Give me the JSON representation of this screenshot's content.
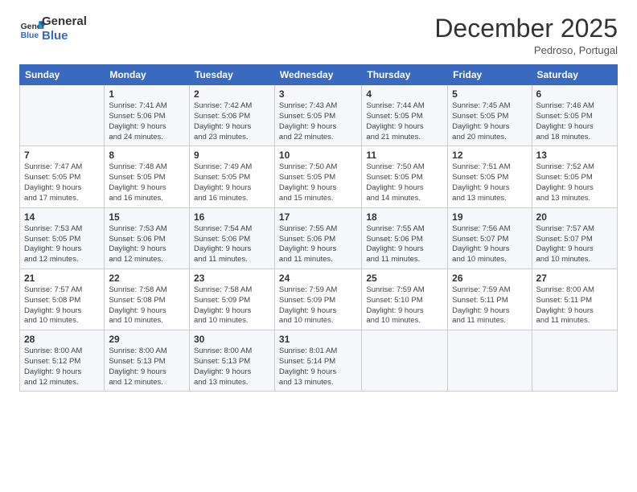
{
  "header": {
    "logo_line1": "General",
    "logo_line2": "Blue",
    "month_title": "December 2025",
    "location": "Pedroso, Portugal"
  },
  "weekdays": [
    "Sunday",
    "Monday",
    "Tuesday",
    "Wednesday",
    "Thursday",
    "Friday",
    "Saturday"
  ],
  "weeks": [
    [
      {
        "day": "",
        "info": ""
      },
      {
        "day": "1",
        "info": "Sunrise: 7:41 AM\nSunset: 5:06 PM\nDaylight: 9 hours\nand 24 minutes."
      },
      {
        "day": "2",
        "info": "Sunrise: 7:42 AM\nSunset: 5:06 PM\nDaylight: 9 hours\nand 23 minutes."
      },
      {
        "day": "3",
        "info": "Sunrise: 7:43 AM\nSunset: 5:05 PM\nDaylight: 9 hours\nand 22 minutes."
      },
      {
        "day": "4",
        "info": "Sunrise: 7:44 AM\nSunset: 5:05 PM\nDaylight: 9 hours\nand 21 minutes."
      },
      {
        "day": "5",
        "info": "Sunrise: 7:45 AM\nSunset: 5:05 PM\nDaylight: 9 hours\nand 20 minutes."
      },
      {
        "day": "6",
        "info": "Sunrise: 7:46 AM\nSunset: 5:05 PM\nDaylight: 9 hours\nand 18 minutes."
      }
    ],
    [
      {
        "day": "7",
        "info": "Sunrise: 7:47 AM\nSunset: 5:05 PM\nDaylight: 9 hours\nand 17 minutes."
      },
      {
        "day": "8",
        "info": "Sunrise: 7:48 AM\nSunset: 5:05 PM\nDaylight: 9 hours\nand 16 minutes."
      },
      {
        "day": "9",
        "info": "Sunrise: 7:49 AM\nSunset: 5:05 PM\nDaylight: 9 hours\nand 16 minutes."
      },
      {
        "day": "10",
        "info": "Sunrise: 7:50 AM\nSunset: 5:05 PM\nDaylight: 9 hours\nand 15 minutes."
      },
      {
        "day": "11",
        "info": "Sunrise: 7:50 AM\nSunset: 5:05 PM\nDaylight: 9 hours\nand 14 minutes."
      },
      {
        "day": "12",
        "info": "Sunrise: 7:51 AM\nSunset: 5:05 PM\nDaylight: 9 hours\nand 13 minutes."
      },
      {
        "day": "13",
        "info": "Sunrise: 7:52 AM\nSunset: 5:05 PM\nDaylight: 9 hours\nand 13 minutes."
      }
    ],
    [
      {
        "day": "14",
        "info": "Sunrise: 7:53 AM\nSunset: 5:05 PM\nDaylight: 9 hours\nand 12 minutes."
      },
      {
        "day": "15",
        "info": "Sunrise: 7:53 AM\nSunset: 5:06 PM\nDaylight: 9 hours\nand 12 minutes."
      },
      {
        "day": "16",
        "info": "Sunrise: 7:54 AM\nSunset: 5:06 PM\nDaylight: 9 hours\nand 11 minutes."
      },
      {
        "day": "17",
        "info": "Sunrise: 7:55 AM\nSunset: 5:06 PM\nDaylight: 9 hours\nand 11 minutes."
      },
      {
        "day": "18",
        "info": "Sunrise: 7:55 AM\nSunset: 5:06 PM\nDaylight: 9 hours\nand 11 minutes."
      },
      {
        "day": "19",
        "info": "Sunrise: 7:56 AM\nSunset: 5:07 PM\nDaylight: 9 hours\nand 10 minutes."
      },
      {
        "day": "20",
        "info": "Sunrise: 7:57 AM\nSunset: 5:07 PM\nDaylight: 9 hours\nand 10 minutes."
      }
    ],
    [
      {
        "day": "21",
        "info": "Sunrise: 7:57 AM\nSunset: 5:08 PM\nDaylight: 9 hours\nand 10 minutes."
      },
      {
        "day": "22",
        "info": "Sunrise: 7:58 AM\nSunset: 5:08 PM\nDaylight: 9 hours\nand 10 minutes."
      },
      {
        "day": "23",
        "info": "Sunrise: 7:58 AM\nSunset: 5:09 PM\nDaylight: 9 hours\nand 10 minutes."
      },
      {
        "day": "24",
        "info": "Sunrise: 7:59 AM\nSunset: 5:09 PM\nDaylight: 9 hours\nand 10 minutes."
      },
      {
        "day": "25",
        "info": "Sunrise: 7:59 AM\nSunset: 5:10 PM\nDaylight: 9 hours\nand 10 minutes."
      },
      {
        "day": "26",
        "info": "Sunrise: 7:59 AM\nSunset: 5:11 PM\nDaylight: 9 hours\nand 11 minutes."
      },
      {
        "day": "27",
        "info": "Sunrise: 8:00 AM\nSunset: 5:11 PM\nDaylight: 9 hours\nand 11 minutes."
      }
    ],
    [
      {
        "day": "28",
        "info": "Sunrise: 8:00 AM\nSunset: 5:12 PM\nDaylight: 9 hours\nand 12 minutes."
      },
      {
        "day": "29",
        "info": "Sunrise: 8:00 AM\nSunset: 5:13 PM\nDaylight: 9 hours\nand 12 minutes."
      },
      {
        "day": "30",
        "info": "Sunrise: 8:00 AM\nSunset: 5:13 PM\nDaylight: 9 hours\nand 13 minutes."
      },
      {
        "day": "31",
        "info": "Sunrise: 8:01 AM\nSunset: 5:14 PM\nDaylight: 9 hours\nand 13 minutes."
      },
      {
        "day": "",
        "info": ""
      },
      {
        "day": "",
        "info": ""
      },
      {
        "day": "",
        "info": ""
      }
    ]
  ]
}
